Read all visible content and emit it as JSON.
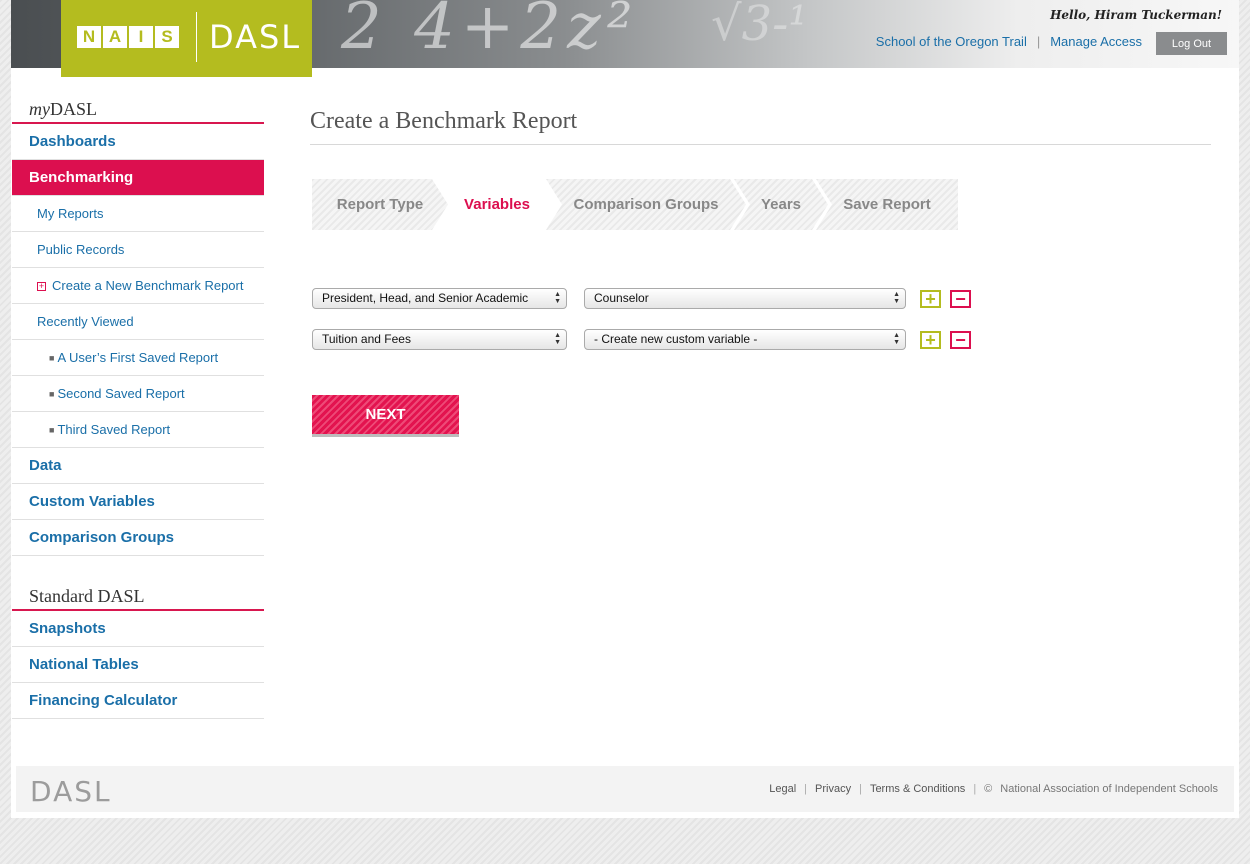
{
  "header": {
    "logo_letters": [
      "N",
      "A",
      "I",
      "S"
    ],
    "logo_text": "DASL",
    "greeting": "Hello, Hiram Tuckerman!",
    "links": [
      "School of the Oregon Trail",
      "Manage Access"
    ],
    "logout_label": "Log Out",
    "chalk_text_1": "2 4+2z²",
    "chalk_text_2": "√3-¹"
  },
  "sidebar": {
    "my_title_prefix": "my",
    "my_title_suffix": "DASL",
    "dashboards": "Dashboards",
    "benchmarking": "Benchmarking",
    "my_reports": "My Reports",
    "public_records": "Public Records",
    "create_new": "Create a New Benchmark Report",
    "recently_viewed": "Recently Viewed",
    "recent_items": [
      "A User’s First Saved Report",
      "Second Saved Report",
      "Third Saved Report"
    ],
    "data": "Data",
    "custom_variables": "Custom Variables",
    "comparison_groups": "Comparison Groups",
    "standard_title": "Standard DASL",
    "snapshots": "Snapshots",
    "national_tables": "National Tables",
    "financing_calculator": "Financing Calculator"
  },
  "main": {
    "title": "Create a Benchmark Report",
    "steps": [
      "Report Type",
      "Variables",
      "Comparison Groups",
      "Years",
      "Save Report"
    ],
    "active_step": "Variables",
    "rows": [
      {
        "left": "President, Head, and Senior Academic",
        "right": "Counselor"
      },
      {
        "left": "Tuition and Fees",
        "right": "- Create new custom variable -"
      }
    ],
    "add_symbol": "+",
    "remove_symbol": "−",
    "next_label": "NEXT"
  },
  "footer": {
    "logo": "DASL",
    "links": [
      "Legal",
      "Privacy",
      "Terms & Conditions"
    ],
    "copyright_symbol": "©",
    "org": "National Association of Independent Schools"
  },
  "colors": {
    "brand_green": "#b4bc1f",
    "accent_pink": "#dc0f4f",
    "link_blue": "#1a6fa8"
  }
}
